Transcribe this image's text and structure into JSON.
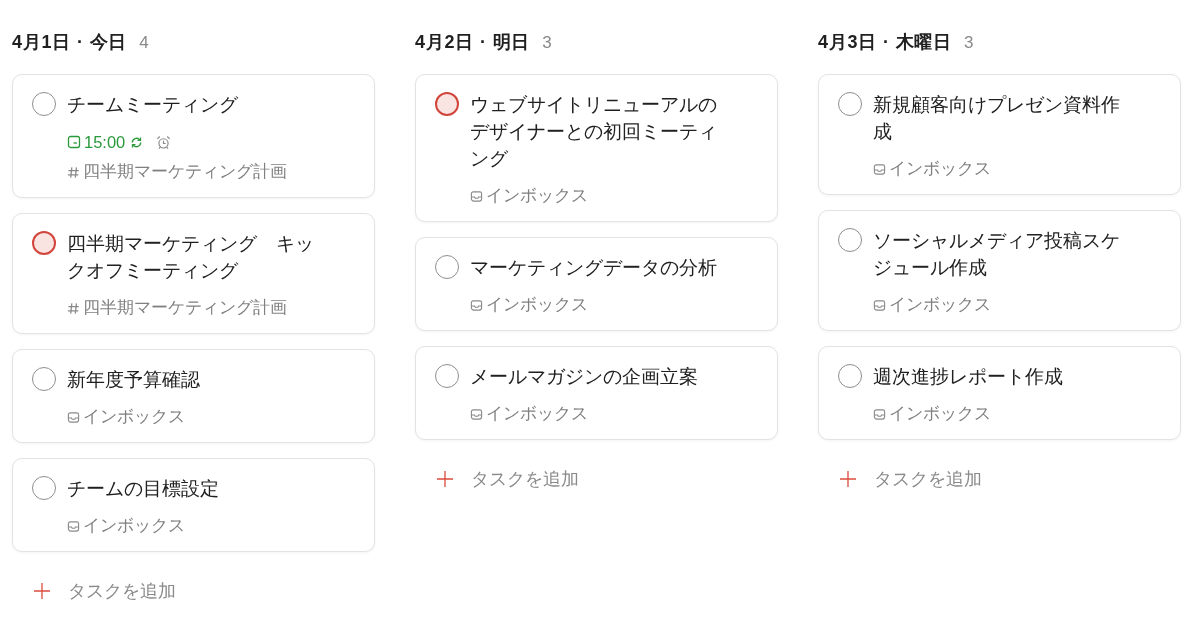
{
  "columns": [
    {
      "date": "4月1日 · 今日",
      "count": "4",
      "tasks": [
        {
          "title": "チームミーティング",
          "high_priority": false,
          "due": {
            "time": "15:00",
            "recurring": true,
            "reminder": true
          },
          "location": {
            "kind": "project",
            "label": "四半期マーケティング計画"
          }
        },
        {
          "title": "四半期マーケティング　キックオフミーティング",
          "high_priority": true,
          "location": {
            "kind": "project",
            "label": "四半期マーケティング計画"
          }
        },
        {
          "title": "新年度予算確認",
          "high_priority": false,
          "location": {
            "kind": "inbox",
            "label": "インボックス"
          }
        },
        {
          "title": "チームの目標設定",
          "high_priority": false,
          "location": {
            "kind": "inbox",
            "label": "インボックス"
          }
        }
      ],
      "add_task": "タスクを追加"
    },
    {
      "date": "4月2日 · 明日",
      "count": "3",
      "tasks": [
        {
          "title": "ウェブサイトリニューアルのデザイナーとの初回ミーティング",
          "high_priority": true,
          "location": {
            "kind": "inbox",
            "label": "インボックス"
          }
        },
        {
          "title": "マーケティングデータの分析",
          "high_priority": false,
          "location": {
            "kind": "inbox",
            "label": "インボックス"
          }
        },
        {
          "title": "メールマガジンの企画立案",
          "high_priority": false,
          "location": {
            "kind": "inbox",
            "label": "インボックス"
          }
        }
      ],
      "add_task": "タスクを追加"
    },
    {
      "date": "4月3日 · 木曜日",
      "count": "3",
      "tasks": [
        {
          "title": "新規顧客向けプレゼン資料作成",
          "high_priority": false,
          "location": {
            "kind": "inbox",
            "label": "インボックス"
          }
        },
        {
          "title": "ソーシャルメディア投稿スケジュール作成",
          "high_priority": false,
          "location": {
            "kind": "inbox",
            "label": "インボックス"
          }
        },
        {
          "title": "週次進捗レポート作成",
          "high_priority": false,
          "location": {
            "kind": "inbox",
            "label": "インボックス"
          }
        }
      ],
      "add_task": "タスクを追加"
    }
  ]
}
